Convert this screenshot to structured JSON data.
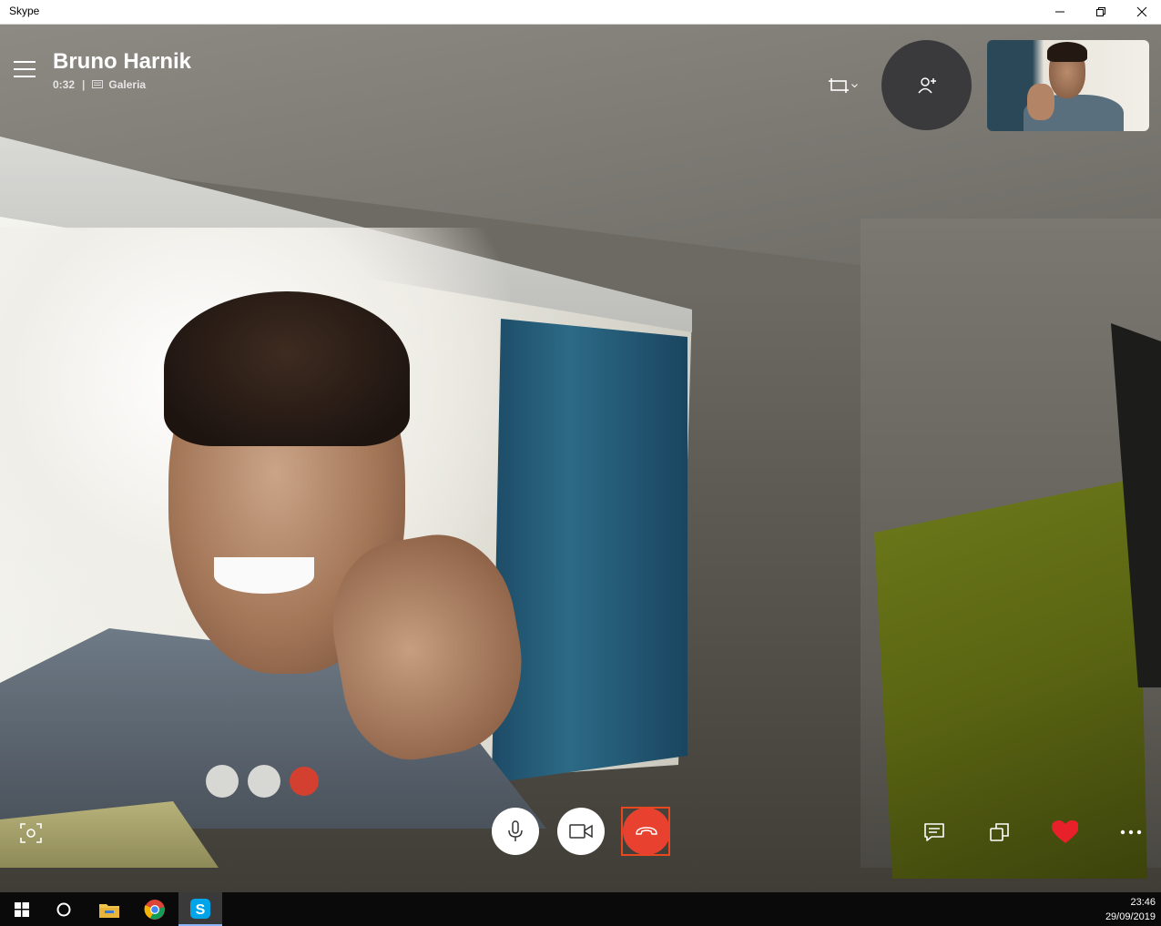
{
  "window": {
    "title": "Skype"
  },
  "call": {
    "contact_name": "Bruno Harnik",
    "duration": "0:32",
    "separator": "|",
    "view_mode": "Galeria"
  },
  "icons": {
    "menu": "hamburger-icon",
    "view_mode": "gallery-icon",
    "layout": "aspect-ratio-icon",
    "add_person": "add-person-icon",
    "screenshot": "camera-capture-icon",
    "mic": "microphone-icon",
    "video": "video-camera-icon",
    "hangup": "hang-up-icon",
    "chat": "chat-icon",
    "share": "share-screen-icon",
    "react": "heart-icon",
    "more": "more-icon"
  },
  "colors": {
    "hangup_red": "#e8412f",
    "focus_outline": "#e8471f",
    "heart_red": "#e8202a",
    "add_button_bg": "#3a3a3c"
  },
  "taskbar": {
    "time": "23:46",
    "date": "29/09/2019",
    "apps": [
      "start",
      "cortana",
      "file-explorer",
      "chrome",
      "skype"
    ]
  }
}
